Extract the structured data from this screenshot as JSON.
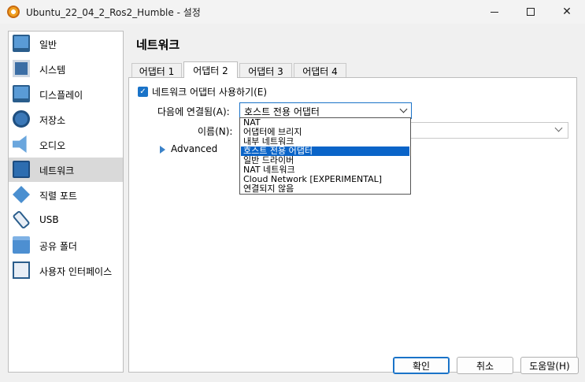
{
  "window": {
    "title": "Ubuntu_22_04_2_Ros2_Humble - 설정",
    "app_icon": "virtualbox-icon"
  },
  "sidebar": {
    "items": [
      {
        "label": "일반",
        "icon": "monitor-icon"
      },
      {
        "label": "시스템",
        "icon": "chip-icon"
      },
      {
        "label": "디스플레이",
        "icon": "display-icon"
      },
      {
        "label": "저장소",
        "icon": "disk-icon"
      },
      {
        "label": "오디오",
        "icon": "speaker-icon"
      },
      {
        "label": "네트워크",
        "icon": "network-icon"
      },
      {
        "label": "직렬 포트",
        "icon": "serial-port-icon"
      },
      {
        "label": "USB",
        "icon": "usb-icon"
      },
      {
        "label": "공유 폴더",
        "icon": "folder-icon"
      },
      {
        "label": "사용자 인터페이스",
        "icon": "user-interface-icon"
      }
    ],
    "selected": "네트워크"
  },
  "main": {
    "title": "네트워크",
    "tabs": [
      {
        "label": "어댑터 1"
      },
      {
        "label": "어댑터 2"
      },
      {
        "label": "어댑터 3"
      },
      {
        "label": "어댑터 4"
      }
    ],
    "active_tab": "어댑터 2",
    "enable_adapter": {
      "label": "네트워크 어댑터 사용하기(E)",
      "checked": true
    },
    "attached_to": {
      "label": "다음에 연결됨(A):",
      "value": "호스트 전용 어댑터"
    },
    "name": {
      "label": "이름(N):",
      "value": ""
    },
    "advanced": {
      "label": "Advanced"
    }
  },
  "dropdown": {
    "options": [
      "NAT",
      "어댑터에 브리지",
      "내부 네트워크",
      "호스트 전용 어댑터",
      "일반 드라이버",
      "NAT 네트워크",
      "Cloud Network [EXPERIMENTAL]",
      "연결되지 않음"
    ],
    "highlighted": "호스트 전용 어댑터"
  },
  "buttons": {
    "ok": "확인",
    "cancel": "취소",
    "help": "도움말(H)"
  },
  "colors": {
    "accent": "#1a73c8",
    "selection": "#0a64c8",
    "sidebar_selected": "#d9d9d9"
  }
}
